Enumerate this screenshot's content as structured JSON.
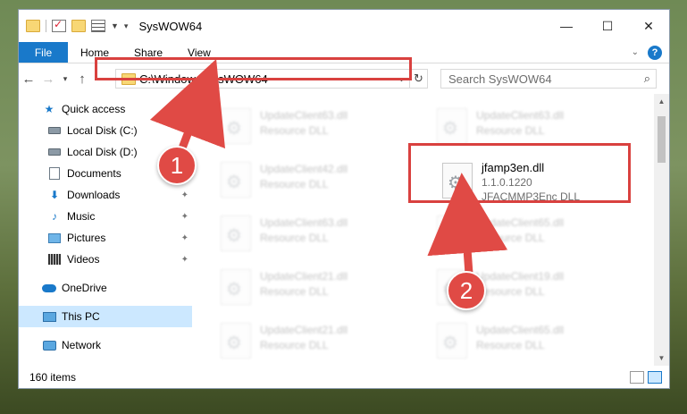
{
  "window": {
    "title": "SysWOW64"
  },
  "ribbon": {
    "file": "File",
    "tabs": [
      "Home",
      "Share",
      "View"
    ]
  },
  "address": {
    "path": "C:\\Windows\\SysWOW64",
    "search_placeholder": "Search SysWOW64"
  },
  "sidebar": {
    "items": [
      {
        "label": "Quick access"
      },
      {
        "label": "Local Disk (C:)"
      },
      {
        "label": "Local Disk (D:)"
      },
      {
        "label": "Documents"
      },
      {
        "label": "Downloads"
      },
      {
        "label": "Music"
      },
      {
        "label": "Pictures"
      },
      {
        "label": "Videos"
      },
      {
        "label": "OneDrive"
      },
      {
        "label": "This PC"
      },
      {
        "label": "Network"
      }
    ]
  },
  "files": [
    {
      "name": "UpdateClient63.dll",
      "desc": "Resource DLL"
    },
    {
      "name": "UpdateClient63.dll",
      "desc": "Resource DLL"
    },
    {
      "name": "UpdateClient42.dll",
      "desc": "Resource DLL"
    },
    {
      "name": "jfamp3en.dll",
      "version": "1.1.0.1220",
      "desc": "JFACMMP3Enc DLL"
    },
    {
      "name": "UpdateClient63.dll",
      "desc": "Resource DLL"
    },
    {
      "name": "UpdateClient65.dll",
      "desc": "Resource DLL"
    },
    {
      "name": "UpdateClient21.dll",
      "desc": "Resource DLL"
    },
    {
      "name": "UpdateClient19.dll",
      "desc": "Resource DLL"
    },
    {
      "name": "UpdateClient21.dll",
      "desc": "Resource DLL"
    },
    {
      "name": "UpdateClient65.dll",
      "desc": "Resource DLL"
    }
  ],
  "status": {
    "count": "160 items"
  },
  "annotations": {
    "step1": "1",
    "step2": "2",
    "color": "#d9413f"
  }
}
